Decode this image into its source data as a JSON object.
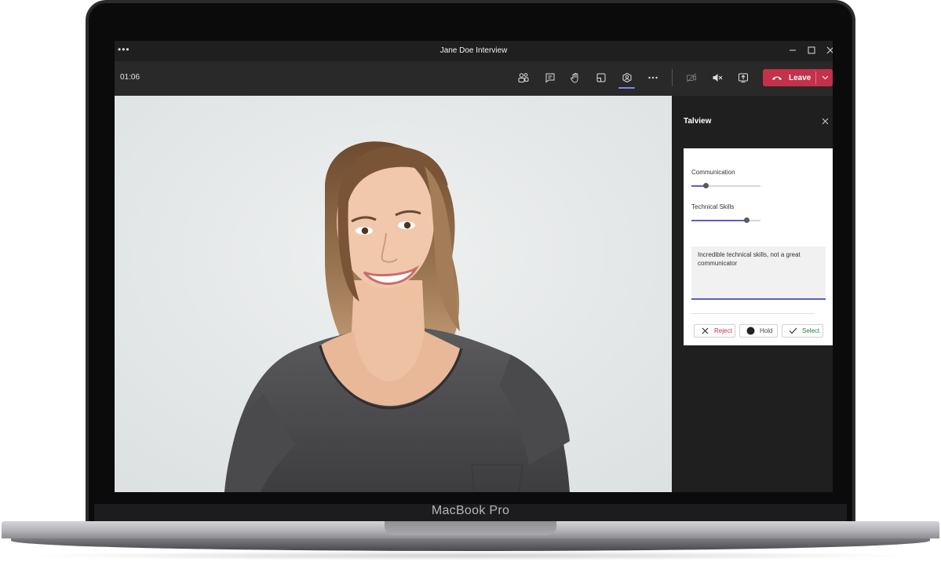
{
  "app": {
    "window_title": "Jane Doe Interview",
    "menu_icon": "more-dots-icon",
    "window_controls": [
      "minimize-icon",
      "maximize-icon",
      "close-icon"
    ]
  },
  "device": {
    "brand_label": "MacBook Pro"
  },
  "toolbar": {
    "timer": "01:06",
    "buttons": [
      {
        "icon": "participants-icon"
      },
      {
        "icon": "chat-icon"
      },
      {
        "icon": "raise-hand-icon"
      },
      {
        "icon": "share-tray-icon"
      },
      {
        "icon": "talview-app-icon",
        "active": true
      },
      {
        "icon": "more-actions-icon"
      },
      {
        "icon": "camera-off-icon"
      },
      {
        "icon": "speaker-mute-icon"
      },
      {
        "icon": "share-screen-icon"
      }
    ],
    "leave_label": "Leave",
    "leave_color": "#c4314b",
    "accent_color": "#7f85f5"
  },
  "video": {
    "subject": "candidate-video-feed"
  },
  "panel": {
    "title": "Talview",
    "sliders": [
      {
        "label": "Communication",
        "value": 0.2
      },
      {
        "label": "Technical Skills",
        "value": 0.8
      }
    ],
    "notes_text": "Incredible technical skills, not a great communicator",
    "actions": [
      {
        "label": "Reject",
        "icon": "x-icon",
        "color": "#c4314b"
      },
      {
        "label": "Hold",
        "icon": "dot-icon",
        "color": "#444444"
      },
      {
        "label": "Select",
        "icon": "check-icon",
        "color": "#237b4b"
      }
    ]
  }
}
